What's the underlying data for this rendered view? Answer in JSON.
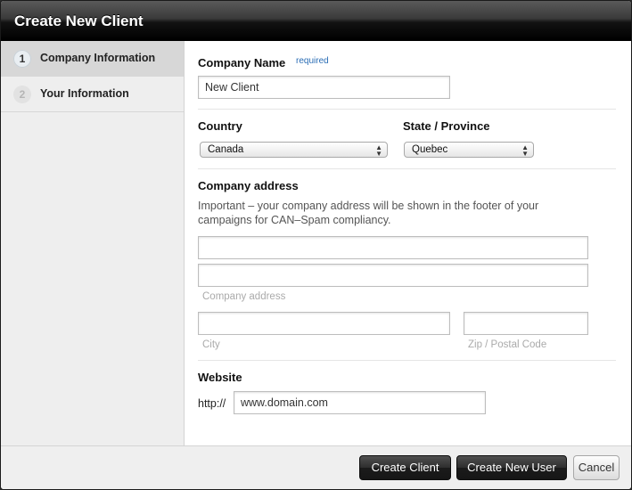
{
  "dialog": {
    "title": "Create New Client"
  },
  "sidebar": {
    "steps": [
      {
        "number": "1",
        "label": "Company Information"
      },
      {
        "number": "2",
        "label": "Your Information"
      }
    ]
  },
  "form": {
    "company_name": {
      "label": "Company Name",
      "required": "required",
      "value": "New Client"
    },
    "country": {
      "label": "Country",
      "selected": "Canada"
    },
    "state": {
      "label": "State / Province",
      "selected": "Quebec"
    },
    "address": {
      "label": "Company address",
      "note_line1": "Important – your company address will be shown in the footer of your",
      "note_line2": "campaigns for CAN–Spam compliancy.",
      "line1_value": "",
      "line2_value": "",
      "line_hint": "Company address",
      "city_value": "",
      "city_hint": "City",
      "zip_value": "",
      "zip_hint": "Zip / Postal Code"
    },
    "website": {
      "label": "Website",
      "prefix": "http://",
      "value": "www.domain.com"
    }
  },
  "footer": {
    "create_client": "Create Client",
    "create_user": "Create New User",
    "cancel": "Cancel"
  }
}
